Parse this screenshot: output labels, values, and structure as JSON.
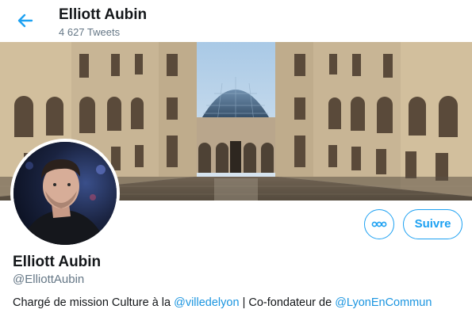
{
  "header": {
    "back_icon": "arrow-left-icon",
    "name": "Elliott Aubin",
    "tweet_count": "4 627 Tweets"
  },
  "banner": {
    "description_icon": "banner-image"
  },
  "profile": {
    "name": "Elliott Aubin",
    "handle": "@ElliottAubin",
    "bio": {
      "text_1": "Chargé de mission Culture à la ",
      "mention_1": "@villedelyon",
      "text_2": " | Co-fondateur de ",
      "mention_2": "@LyonEnCommun"
    }
  },
  "actions": {
    "more_icon": "more-dots-icon",
    "follow_label": "Suivre"
  },
  "colors": {
    "accent": "#1da1f2",
    "text": "#14171a",
    "muted": "#657786",
    "link": "#1b95e0"
  }
}
